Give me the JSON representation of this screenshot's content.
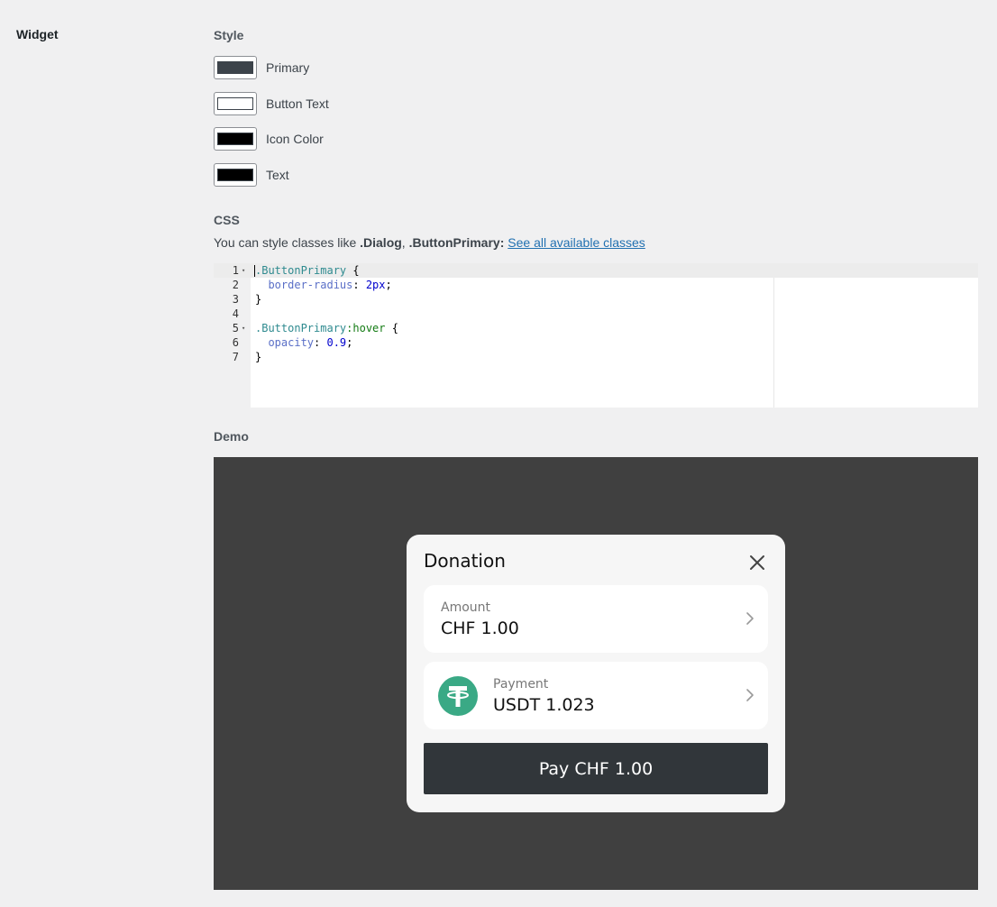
{
  "settings": {
    "row_label": "Widget",
    "style_heading": "Style",
    "colors": [
      {
        "label": "Primary",
        "value": "#3c434a"
      },
      {
        "label": "Button Text",
        "value": "#ffffff"
      },
      {
        "label": "Icon Color",
        "value": "#000000"
      },
      {
        "label": "Text",
        "value": "#000000"
      }
    ],
    "css_heading": "CSS",
    "css_desc_prefix": "You can style classes like ",
    "css_desc_class1": ".Dialog",
    "css_desc_sep": ", ",
    "css_desc_class2": ".ButtonPrimary",
    "css_desc_colon": ": ",
    "css_desc_link": "See all available classes",
    "demo_heading": "Demo"
  },
  "editor": {
    "line_numbers": [
      "1",
      "2",
      "3",
      "4",
      "5",
      "6",
      "7"
    ],
    "lines": [
      {
        "selector": ".ButtonPrimary",
        "rest": " {"
      },
      {
        "indent": "  ",
        "prop": "border-radius",
        "colon": ": ",
        "value": "2px",
        "end": ";"
      },
      {
        "plain": "}"
      },
      {
        "plain": ""
      },
      {
        "selector": ".ButtonPrimary",
        "pseudo": ":hover",
        "rest": " {"
      },
      {
        "indent": "  ",
        "prop": "opacity",
        "colon": ": ",
        "value": "0.9",
        "end": ";"
      },
      {
        "plain": "}"
      }
    ],
    "fold_marker": "▾"
  },
  "demo": {
    "dialog_title": "Donation",
    "amount_label": "Amount",
    "amount_value": "CHF 1.00",
    "payment_label": "Payment",
    "payment_value": "USDT 1.023",
    "pay_button": "Pay CHF 1.00",
    "icons": {
      "close": "close-icon",
      "chevron": "chevron-right-icon",
      "token": "tether-icon"
    },
    "colors": {
      "overlay": "#404040",
      "dialog": "#f6f6f6",
      "button": "#31363a",
      "tether": "#3aa985"
    }
  }
}
